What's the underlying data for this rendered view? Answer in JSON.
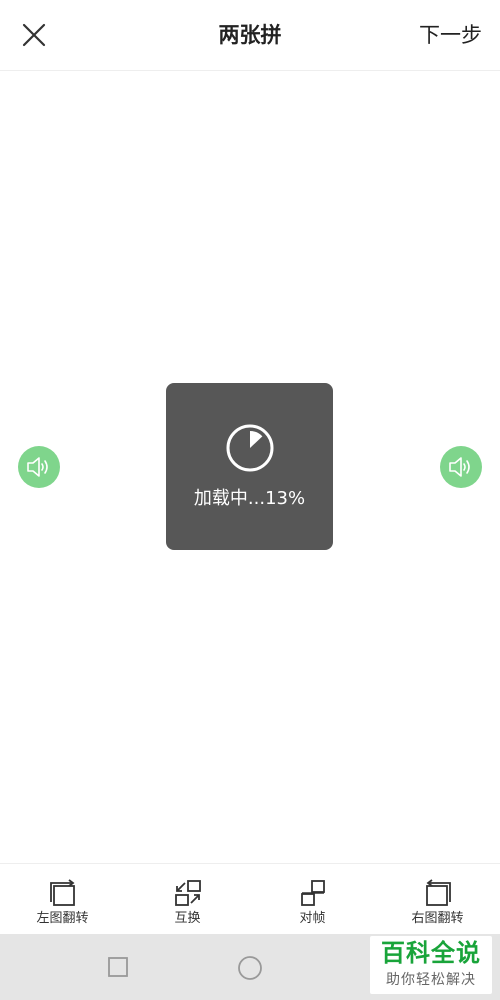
{
  "header": {
    "title": "两张拼",
    "next_label": "下一步",
    "close_icon": "close-icon"
  },
  "loading": {
    "text": "加载中...13%",
    "progress": 0.13
  },
  "audio": {
    "left_icon": "speaker-icon",
    "right_icon": "speaker-icon",
    "accent_color": "#7fd58c"
  },
  "toolbar": {
    "items": [
      {
        "label": "左图翻转",
        "icon": "flip-left-icon"
      },
      {
        "label": "互换",
        "icon": "swap-icon"
      },
      {
        "label": "对帧",
        "icon": "align-frames-icon"
      },
      {
        "label": "右图翻转",
        "icon": "flip-right-icon"
      }
    ]
  },
  "navbar": {
    "buttons": [
      "recent-apps-icon",
      "home-icon"
    ]
  },
  "watermark": {
    "main": "百科全说",
    "sub": "助你轻松解决"
  }
}
